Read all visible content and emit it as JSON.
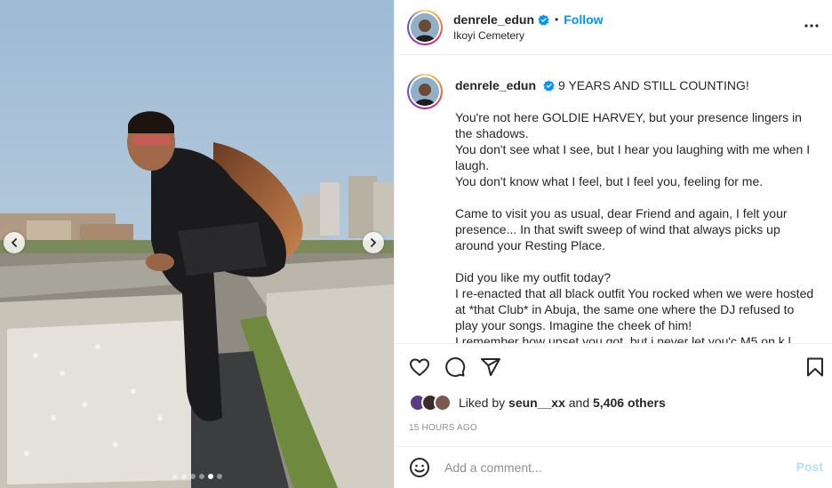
{
  "header": {
    "username": "denrele_edun",
    "separator": "•",
    "follow_label": "Follow",
    "location": "Ikoyi Cemetery"
  },
  "caption": {
    "username": "denrele_edun",
    "title": "9 YEARS AND STILL COUNTING!",
    "paragraphs": [
      [
        "You're not here GOLDIE HARVEY, but your presence lingers in the shadows.",
        "You don't see what I see, but I hear you laughing with me when I laugh.",
        "You don't know what I feel, but I feel you, feeling for me."
      ],
      [
        "Came to visit you as usual, dear Friend and again, I felt your presence... In that swift sweep of wind that always picks up around your Resting Place."
      ],
      [
        "Did you like my outfit today?",
        "I re-enacted that all black outfit You rocked when we were hosted at *that Club* in Abuja, the same one where the DJ refused to play your songs. Imagine the cheek of him!",
        "I remember how upset you got, but i never let you'c M5 on k l..."
      ]
    ]
  },
  "likes": {
    "prefix": "Liked by",
    "user": "seun__xx",
    "connector": "and",
    "others": "5,406 others"
  },
  "timestamp": "15 HOURS AGO",
  "comment": {
    "placeholder": "Add a comment...",
    "post_label": "Post"
  },
  "carousel": {
    "dot_count": 6,
    "active_index": 4
  },
  "colors": {
    "accent": "#0095f6",
    "post_disabled": "#b2dffc",
    "muted": "#8e8e8e",
    "text": "#262626"
  },
  "icons": [
    "more-horizontal-icon",
    "heart-icon",
    "comment-icon",
    "share-icon",
    "bookmark-icon",
    "emoji-icon",
    "chevron-left-icon",
    "chevron-right-icon",
    "verified-badge-icon"
  ]
}
